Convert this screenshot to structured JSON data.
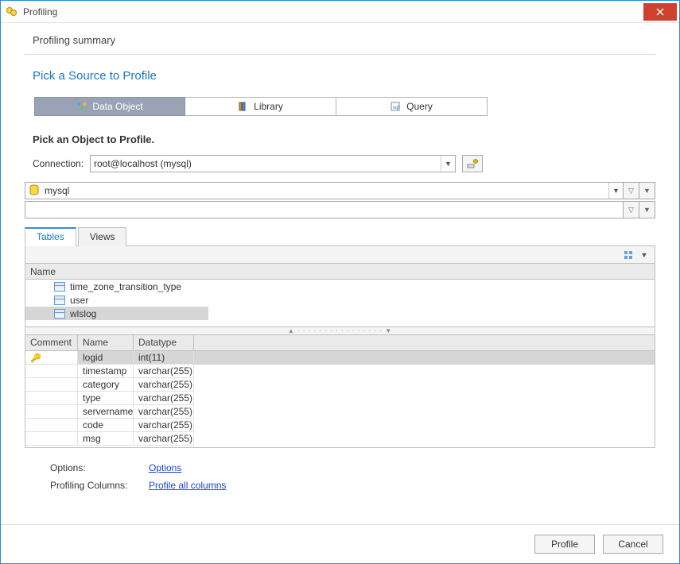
{
  "titlebar": {
    "title": "Profiling"
  },
  "summary_title": "Profiling summary",
  "pick_source_title": "Pick a Source to Profile",
  "source_tabs": {
    "data_object": "Data Object",
    "library": "Library",
    "query": "Query"
  },
  "pick_object_title": "Pick an Object to Profile.",
  "connection": {
    "label": "Connection:",
    "value": "root@localhost (mysql)"
  },
  "database": {
    "value": "mysql"
  },
  "inner_tabs": {
    "tables": "Tables",
    "views": "Views"
  },
  "object_list": {
    "header": "Name",
    "rows": [
      {
        "name": "time_zone_transition_type"
      },
      {
        "name": "user"
      },
      {
        "name": "wlslog",
        "selected": true
      }
    ]
  },
  "columns": {
    "headers": {
      "comment": "Comment",
      "name": "Name",
      "datatype": "Datatype"
    },
    "rows": [
      {
        "pk": true,
        "name": "logid",
        "datatype": "int(11)"
      },
      {
        "pk": false,
        "name": "timestamp",
        "datatype": "varchar(255)"
      },
      {
        "pk": false,
        "name": "category",
        "datatype": "varchar(255)"
      },
      {
        "pk": false,
        "name": "type",
        "datatype": "varchar(255)"
      },
      {
        "pk": false,
        "name": "servername",
        "datatype": "varchar(255)"
      },
      {
        "pk": false,
        "name": "code",
        "datatype": "varchar(255)"
      },
      {
        "pk": false,
        "name": "msg",
        "datatype": "varchar(255)"
      }
    ]
  },
  "options": {
    "options_label": "Options:",
    "options_link": "Options",
    "columns_label": "Profiling Columns:",
    "columns_link": "Profile all columns"
  },
  "footer": {
    "profile": "Profile",
    "cancel": "Cancel"
  }
}
